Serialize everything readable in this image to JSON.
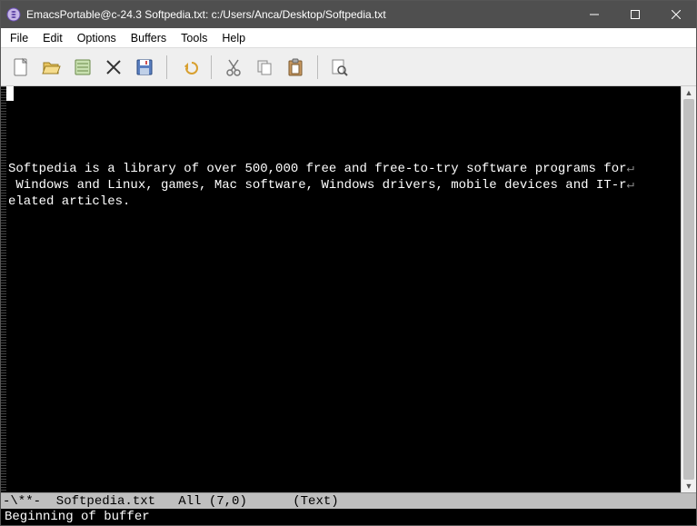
{
  "titlebar": {
    "title": "EmacsPortable@c-24.3 Softpedia.txt: c:/Users/Anca/Desktop/Softpedia.txt"
  },
  "menu": {
    "items": [
      "File",
      "Edit",
      "Options",
      "Buffers",
      "Tools",
      "Help"
    ]
  },
  "toolbar": {
    "buttons": [
      {
        "name": "new-file-icon"
      },
      {
        "name": "open-file-icon"
      },
      {
        "name": "dired-icon"
      },
      {
        "name": "close-icon"
      },
      {
        "name": "save-icon"
      },
      {
        "sep": true
      },
      {
        "name": "undo-icon"
      },
      {
        "sep": true
      },
      {
        "name": "cut-icon"
      },
      {
        "name": "copy-icon"
      },
      {
        "name": "paste-icon"
      },
      {
        "sep": true
      },
      {
        "name": "search-icon"
      }
    ]
  },
  "editor": {
    "line1": "Softpedia is a library of over 500,000 free and free-to-try software programs for",
    "line2": " Windows and Linux, games, Mac software, Windows drivers, mobile devices and IT-r",
    "line3": "elated articles."
  },
  "modeline": {
    "text": "-\\**-  Softpedia.txt   All (7,0)      (Text) "
  },
  "echo": {
    "text": "Beginning of buffer"
  }
}
